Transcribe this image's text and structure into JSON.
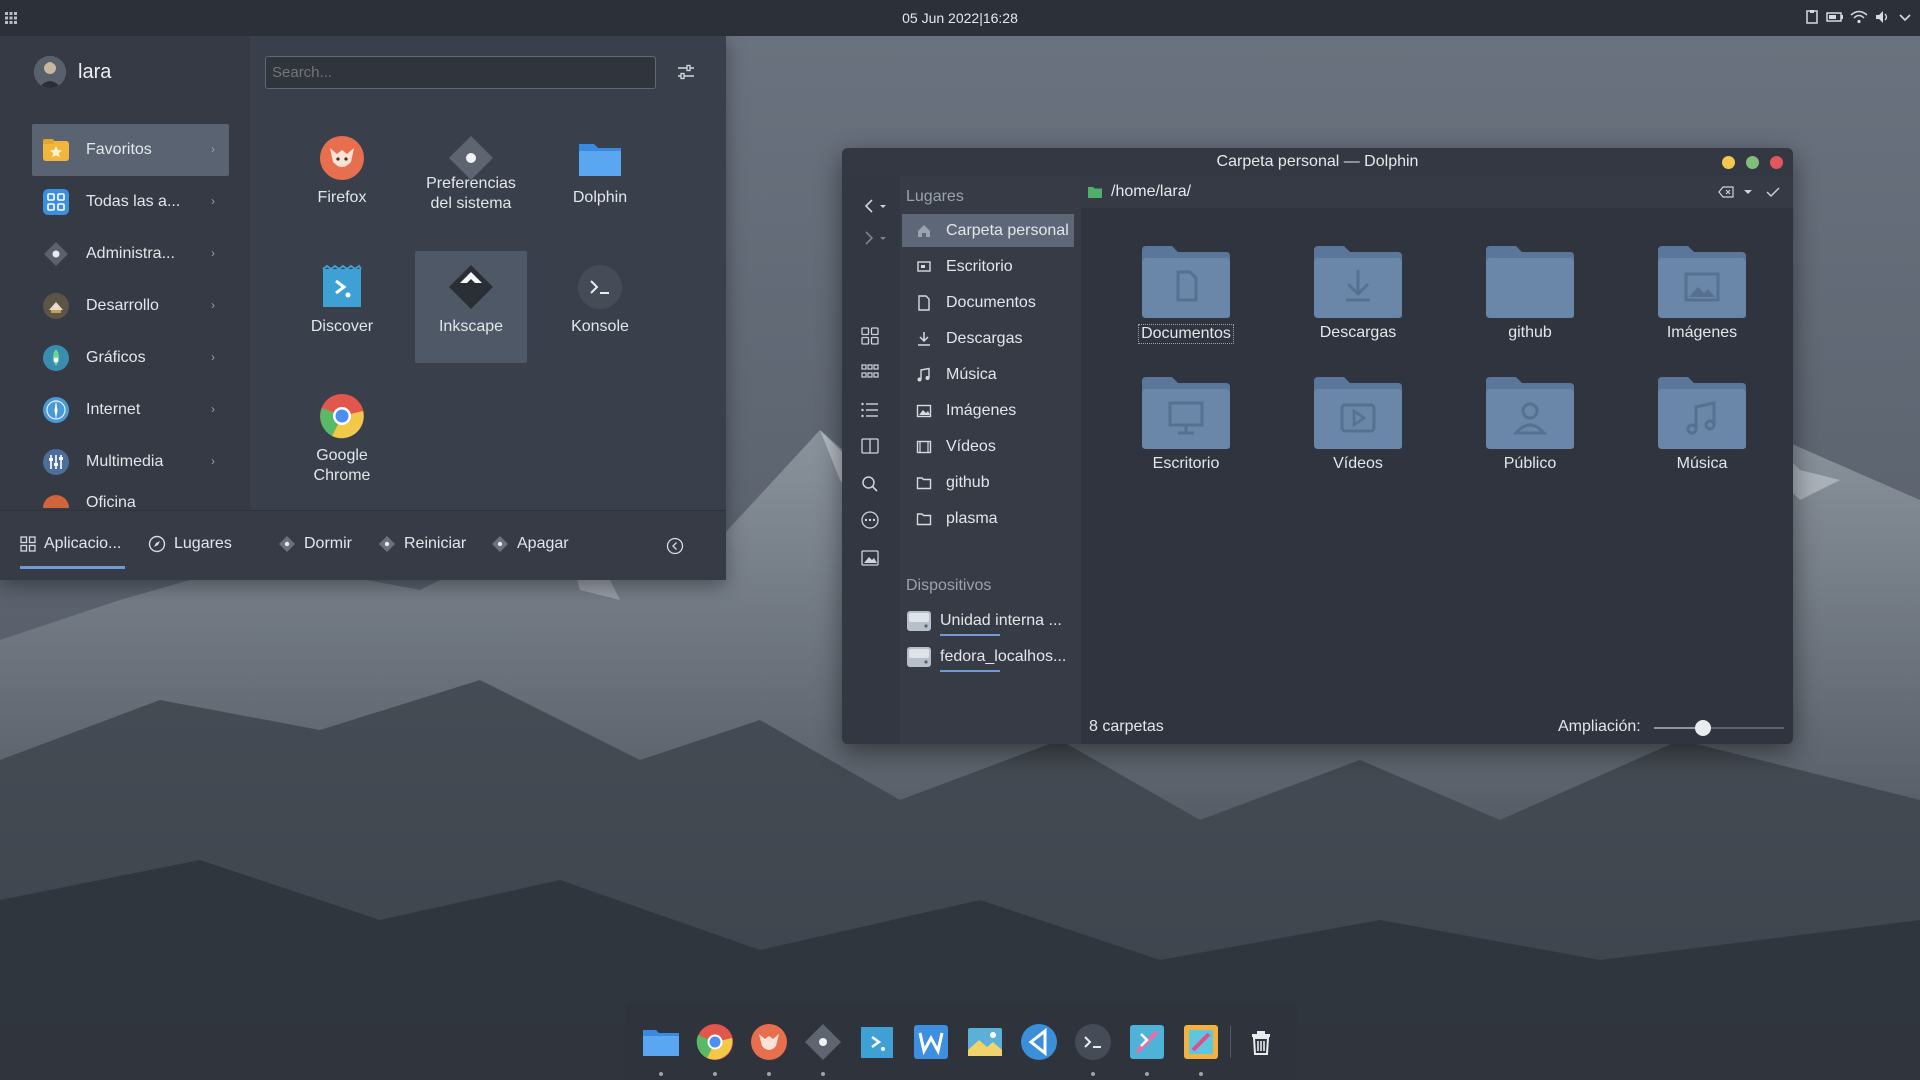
{
  "top_panel": {
    "clock": "05 Jun 2022|16:28"
  },
  "app_menu": {
    "user_name": "lara",
    "search_placeholder": "Search...",
    "categories": [
      {
        "label": "Favoritos",
        "icon": "star-folder-icon",
        "active": true
      },
      {
        "label": "Todas las a...",
        "icon": "grid-apps-icon"
      },
      {
        "label": "Administra...",
        "icon": "admin-icon"
      },
      {
        "label": "Desarrollo",
        "icon": "development-icon"
      },
      {
        "label": "Gráficos",
        "icon": "graphics-icon"
      },
      {
        "label": "Internet",
        "icon": "internet-icon"
      },
      {
        "label": "Multimedia",
        "icon": "multimedia-icon"
      },
      {
        "label": "Oficina",
        "icon": "office-icon"
      }
    ],
    "apps": [
      {
        "label": "Firefox",
        "icon": "firefox-icon"
      },
      {
        "label": "Preferencias del sistema",
        "icon": "system-settings-icon"
      },
      {
        "label": "Dolphin",
        "icon": "folder-icon"
      },
      {
        "label": "Discover",
        "icon": "discover-icon"
      },
      {
        "label": "Inkscape",
        "icon": "inkscape-icon",
        "active": true
      },
      {
        "label": "Konsole",
        "icon": "terminal-icon"
      },
      {
        "label": "Google Chrome",
        "icon": "chrome-icon"
      }
    ],
    "bottom": {
      "applications_tab": "Aplicacio...",
      "places_tab": "Lugares",
      "sleep": "Dormir",
      "restart": "Reiniciar",
      "shutdown": "Apagar"
    }
  },
  "dolphin": {
    "title": "Carpeta personal — Dolphin",
    "places_header": "Lugares",
    "places": [
      {
        "label": "Carpeta personal",
        "icon": "home-icon",
        "active": true
      },
      {
        "label": "Escritorio",
        "icon": "desktop-icon"
      },
      {
        "label": "Documentos",
        "icon": "document-icon"
      },
      {
        "label": "Descargas",
        "icon": "download-icon"
      },
      {
        "label": "Música",
        "icon": "music-icon"
      },
      {
        "label": "Imágenes",
        "icon": "image-icon"
      },
      {
        "label": "Vídeos",
        "icon": "video-icon"
      },
      {
        "label": "github",
        "icon": "folder-icon"
      },
      {
        "label": "plasma",
        "icon": "folder-icon"
      }
    ],
    "devices_header": "Dispositivos",
    "devices": [
      {
        "label": "Unidad interna ...",
        "icon": "drive-icon"
      },
      {
        "label": "fedora_localhos...",
        "icon": "drive-icon"
      }
    ],
    "path": "/home/lara/",
    "folders": [
      {
        "label": "Documentos",
        "icon": "document-icon",
        "focused": true
      },
      {
        "label": "Descargas",
        "icon": "download-icon"
      },
      {
        "label": "github",
        "icon": "none"
      },
      {
        "label": "Imágenes",
        "icon": "image-icon"
      },
      {
        "label": "Escritorio",
        "icon": "desktop-icon"
      },
      {
        "label": "Vídeos",
        "icon": "video-icon"
      },
      {
        "label": "Público",
        "icon": "user-icon"
      },
      {
        "label": "Música",
        "icon": "music-icon"
      }
    ],
    "status": "8 carpetas",
    "zoom_label": "Ampliación:",
    "zoom_level": 0.38
  },
  "dock": {
    "items": [
      "files-icon",
      "chrome-icon",
      "firefox-icon",
      "settings-icon",
      "discover-icon",
      "writer-icon",
      "image-viewer-icon",
      "vscode-icon",
      "terminal-icon",
      "kdevelop-icon",
      "krita-icon",
      "trash-icon"
    ]
  },
  "colors": {
    "accent": "#6f9ad6",
    "panel": "#2c3039",
    "folder": "#6a86a8",
    "close_button": "#e0585e",
    "minimize_button": "#f2c94c",
    "maximize_button": "#7fbf7a"
  }
}
